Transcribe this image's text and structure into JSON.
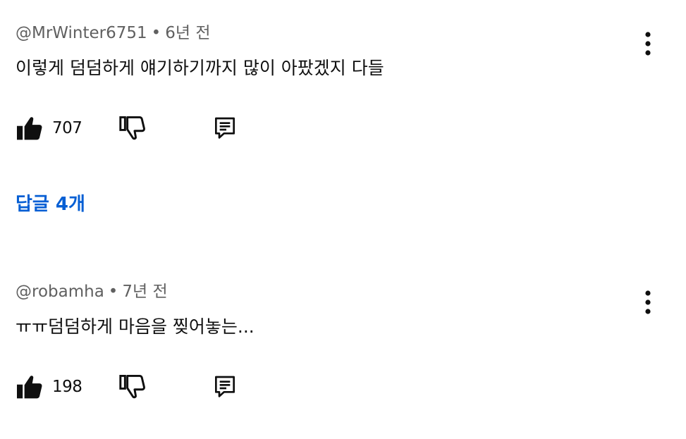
{
  "comments": [
    {
      "author": "@MrWinter6751",
      "separator": "•",
      "time": "6년 전",
      "text": "이렇게 덤덤하게 얘기하기까지 많이 아팠겠지 다들",
      "likes": "707",
      "icons": {
        "like": "thumbs-up-icon",
        "dislike": "thumbs-down-icon",
        "reply": "comment-icon",
        "more": "more-vert-icon"
      }
    },
    {
      "author": "@robamha",
      "separator": "•",
      "time": "7년 전",
      "text": "ㅠㅠ덤덤하게 마음을 찢어놓는...",
      "likes": "198",
      "icons": {
        "like": "thumbs-up-icon",
        "dislike": "thumbs-down-icon",
        "reply": "comment-icon",
        "more": "more-vert-icon"
      }
    }
  ],
  "replies_link": "답글 4개",
  "colors": {
    "text": "#0f0f0f",
    "meta": "#606060",
    "link": "#065fd4",
    "background": "#ffffff"
  }
}
